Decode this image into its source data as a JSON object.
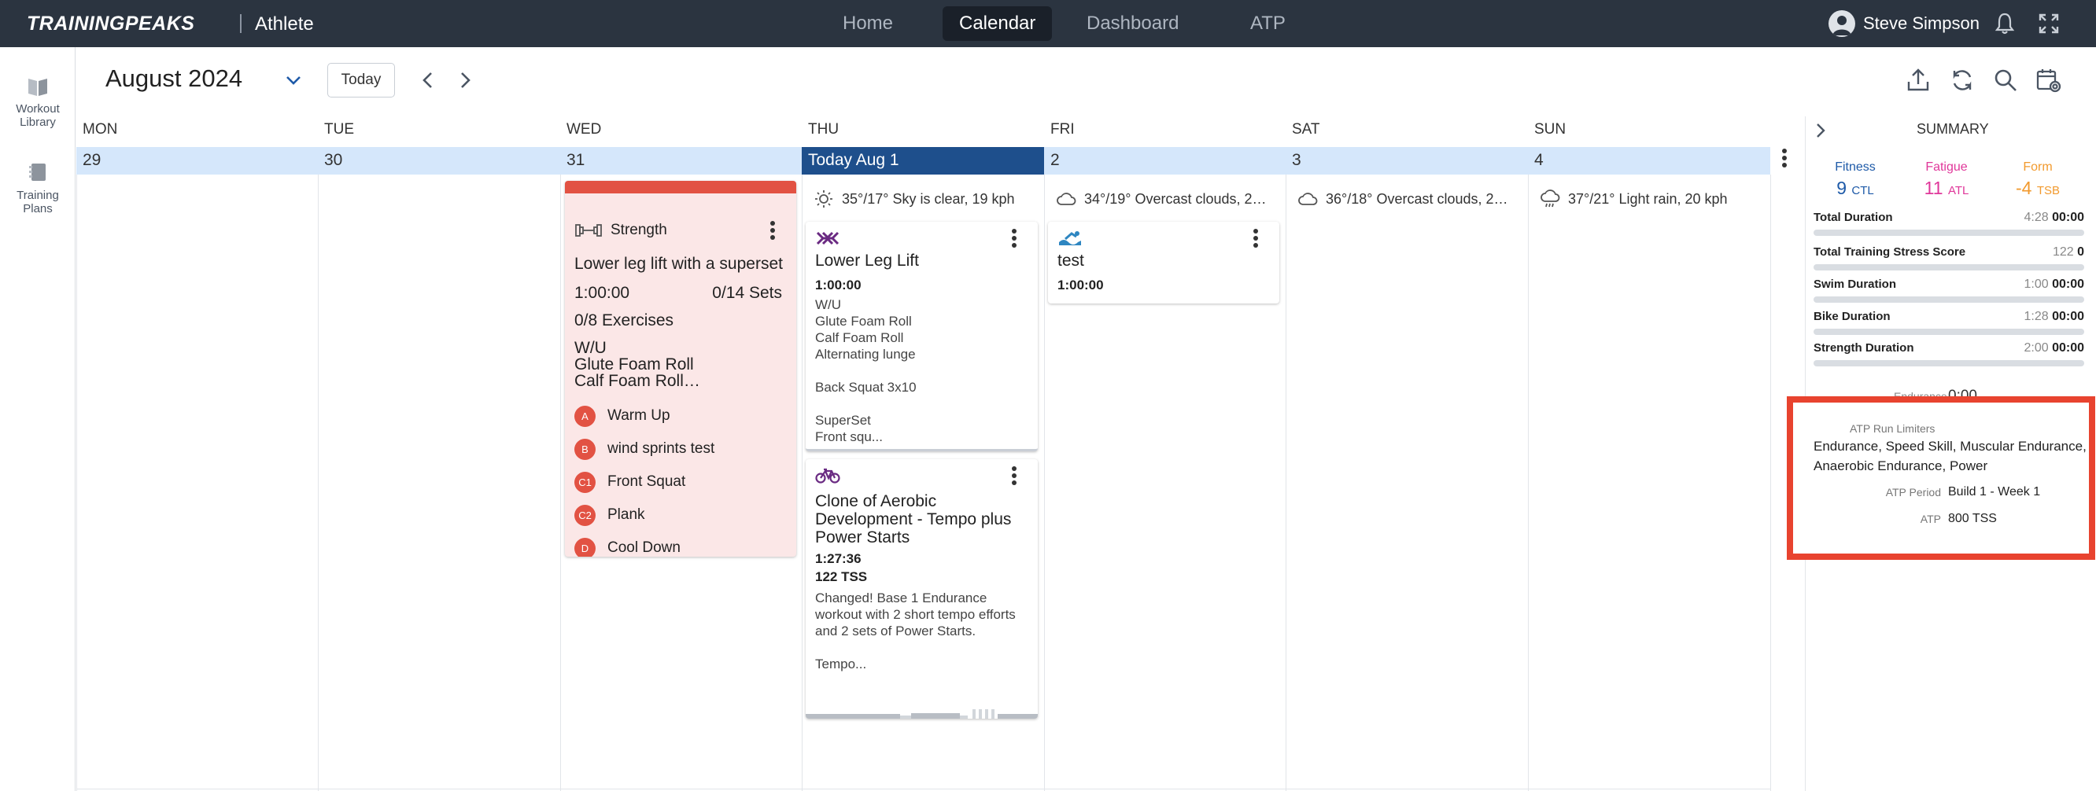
{
  "topbar": {
    "logo": "TRAININGPEAKS",
    "logo_sub": "Athlete",
    "nav": [
      "Home",
      "Calendar",
      "Dashboard",
      "ATP"
    ],
    "active_nav": "Calendar",
    "user_name": "Steve Simpson"
  },
  "rail": {
    "workout_library": "Workout\nLibrary",
    "training_plans": "Training\nPlans"
  },
  "calendar": {
    "month": "August 2024",
    "today_button": "Today",
    "days": [
      "MON",
      "TUE",
      "WED",
      "THU",
      "FRI",
      "SAT",
      "SUN"
    ],
    "dates": [
      "29",
      "30",
      "31",
      "Today Aug 1",
      "2",
      "3",
      "4"
    ],
    "weather": {
      "thu": "35°/17° Sky is clear, 19 kph",
      "fri": "34°/19° Overcast clouds, 2…",
      "sat": "36°/18° Overcast clouds, 2…",
      "sun": "37°/21° Light rain, 20 kph"
    }
  },
  "strength_card": {
    "type": "Strength",
    "title": "Lower leg lift with a superset",
    "duration": "1:00:00",
    "sets": "0/14 Sets",
    "exercises_count": "0/8 Exercises",
    "description": "W/U\nGlute Foam Roll\nCalf Foam Roll…",
    "exercises": [
      {
        "badge": "A",
        "name": "Warm Up"
      },
      {
        "badge": "B",
        "name": "wind sprints test"
      },
      {
        "badge": "C1",
        "name": "Front Squat"
      },
      {
        "badge": "C2",
        "name": "Plank"
      },
      {
        "badge": "D",
        "name": "Cool Down"
      }
    ]
  },
  "thu_card1": {
    "title": "Lower Leg Lift",
    "duration": "1:00:00",
    "description": "W/U\nGlute Foam Roll\nCalf Foam Roll\nAlternating lunge\n\nBack Squat 3x10\n\nSuperSet\nFront squ..."
  },
  "thu_card2": {
    "title": "Clone of Aerobic Development - Tempo plus Power Starts",
    "duration": "1:27:36",
    "tss": "122 TSS",
    "description": "Changed! Base 1 Endurance workout with 2 short tempo efforts and 2 sets of Power Starts.\n\nTempo..."
  },
  "fri_card": {
    "title": "test",
    "duration": "1:00:00"
  },
  "summary": {
    "heading": "SUMMARY",
    "fitness": {
      "label": "Fitness",
      "value": "9",
      "unit": "CTL"
    },
    "fatigue": {
      "label": "Fatigue",
      "value": "11",
      "unit": "ATL"
    },
    "form": {
      "label": "Form",
      "value": "-4",
      "unit": "TSB"
    },
    "stats": [
      {
        "label": "Total Duration",
        "planned": "4:28",
        "completed": "00:00"
      },
      {
        "label": "Total Training Stress Score",
        "planned": "122",
        "completed": "0"
      },
      {
        "label": "Swim Duration",
        "planned": "1:00",
        "completed": "00:00"
      },
      {
        "label": "Bike Duration",
        "planned": "1:28",
        "completed": "00:00"
      },
      {
        "label": "Strength Duration",
        "planned": "2:00",
        "completed": "00:00"
      }
    ],
    "endurance_peek_label": "Endurance",
    "endurance_peek_value": "0:00",
    "atp_limiters_label": "ATP Run Limiters",
    "atp_limiters_value": "Endurance, Speed Skill, Muscular Endurance, Anaerobic Endurance, Power",
    "atp_period_label": "ATP Period",
    "atp_period_value": "Build 1 - Week 1",
    "atp_label": "ATP",
    "atp_value": "800 TSS"
  },
  "colors": {
    "topbar": "#2b3440",
    "strength_accent": "#e25243",
    "today_header": "#1e4f8c",
    "week_header": "#d5e7fb",
    "fitness": "#1e5aa8",
    "fatigue": "#e0379a",
    "form": "#f29a2e",
    "highlight_box": "#e8432f"
  }
}
